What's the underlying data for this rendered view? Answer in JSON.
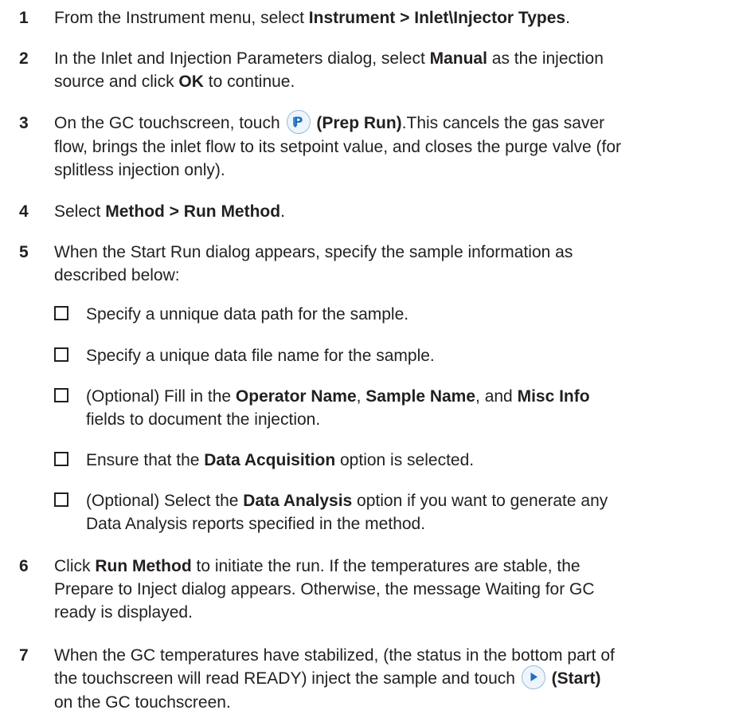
{
  "steps": [
    {
      "num": "1",
      "parts": [
        "From the Instrument menu, select ",
        "Instrument > Inlet\\Injector Types",
        "."
      ]
    },
    {
      "num": "2",
      "line1": [
        "In the Inlet and Injection Parameters dialog, select ",
        "Manual",
        " as the injection"
      ],
      "line2": [
        "source and click ",
        "OK",
        " to continue."
      ]
    },
    {
      "num": "3",
      "line1": [
        "On the GC touchscreen, touch ",
        "(Prep Run)",
        ".This cancels the gas saver"
      ],
      "line2": "flow, brings the inlet flow to its setpoint value, and closes the purge valve (for",
      "line3": "splitless injection only).",
      "icon": "prep-run-icon"
    },
    {
      "num": "4",
      "parts": [
        "Select ",
        "Method > Run Method",
        "."
      ]
    },
    {
      "num": "5",
      "line1": "When the Start Run dialog appears, specify the sample information as",
      "line2": "described below:"
    },
    {
      "num": "6",
      "line1": [
        "Click ",
        "Run Method",
        " to initiate the run. If the temperatures are stable, the"
      ],
      "line2": "Prepare to Inject dialog appears. Otherwise, the message Waiting for GC",
      "line3": "ready is displayed."
    },
    {
      "num": "7",
      "line1": "When the GC temperatures have stabilized, (the status in the bottom part of",
      "line2": [
        "the touchscreen will read READY) inject the sample and touch ",
        "(Start)"
      ],
      "line3": "on the GC touchscreen.",
      "icon": "start-icon"
    }
  ],
  "checklist": [
    {
      "text": "Specify a unnique data path for the sample."
    },
    {
      "text": "Specify a unique data file name for the sample."
    },
    {
      "line1": [
        "(Optional) Fill in the ",
        "Operator Name",
        ", ",
        "Sample Name",
        ", and ",
        "Misc Info"
      ],
      "line2": "fields to document the injection."
    },
    {
      "parts": [
        "Ensure that the ",
        "Data Acquisition",
        " option is selected."
      ]
    },
    {
      "line1": [
        "(Optional) Select the ",
        "Data Analysis",
        " option if you want to generate any"
      ],
      "line2": "Data Analysis reports specified in the method."
    }
  ]
}
